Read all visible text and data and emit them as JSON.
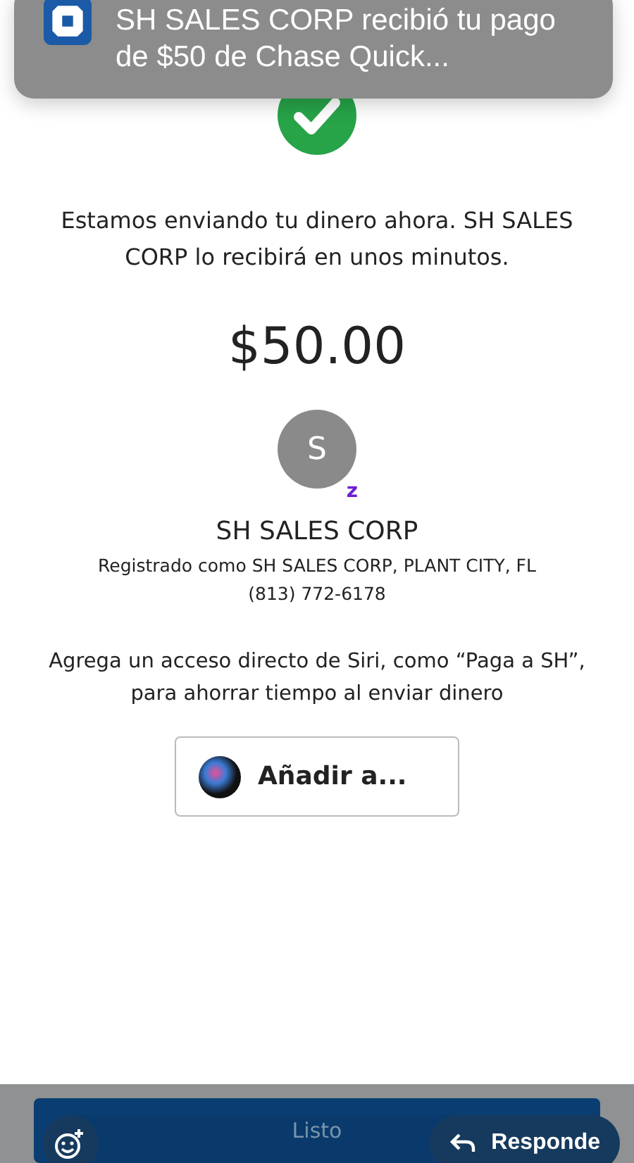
{
  "notification": {
    "message": "SH SALES CORP recibió tu pago de $50 de Chase Quick..."
  },
  "status_message": "Estamos enviando tu dinero ahora. SH SALES CORP lo recibirá en unos minutos.",
  "amount": "$50.00",
  "recipient": {
    "initial": "S",
    "badge": "z",
    "name": "SH SALES CORP",
    "registered": "Registrado como SH SALES CORP, PLANT CITY, FL",
    "phone": "(813) 772-6178"
  },
  "siri": {
    "text": "Agrega un acceso directo de Siri, como “Paga a SH”, para ahorrar tiempo al enviar dinero",
    "button": "Añadir a..."
  },
  "done_button": "Listo",
  "reply_button": "Responde"
}
